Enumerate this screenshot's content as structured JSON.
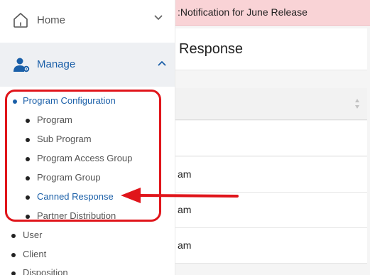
{
  "notification": {
    "text": ":Notification for June Release"
  },
  "page": {
    "title": "Response"
  },
  "table": {
    "rows": [
      "",
      "am",
      "am",
      "am"
    ]
  },
  "sidebar": {
    "home_label": "Home",
    "manage_label": "Manage",
    "program_configuration": {
      "label": "Program Configuration",
      "items": [
        {
          "label": "Program"
        },
        {
          "label": "Sub Program"
        },
        {
          "label": "Program Access Group"
        },
        {
          "label": "Program Group"
        },
        {
          "label": "Canned Response"
        },
        {
          "label": "Partner Distribution"
        }
      ]
    },
    "more_items": [
      {
        "label": "User"
      },
      {
        "label": "Client"
      },
      {
        "label": "Disposition"
      }
    ]
  },
  "icons": {
    "home": "home-icon",
    "manage": "user-gear-icon",
    "home_chevron": "chevron-down-icon",
    "manage_chevron": "chevron-up-icon",
    "sort": "sort-icon"
  },
  "colors": {
    "accent": "#1a5fa8",
    "banner": "#f9d3d6",
    "annotation": "#e0151b"
  }
}
